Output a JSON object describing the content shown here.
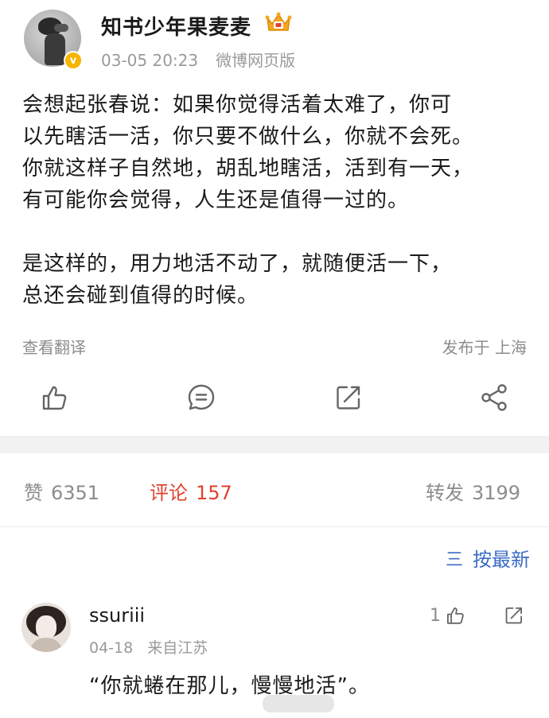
{
  "post": {
    "username": "知书少年果麦麦",
    "date": "03-05 20:23",
    "source": "微博网页版",
    "verify_mark": "v",
    "body_lines": [
      "会想起张春说：如果你觉得活着太难了，你可",
      "以先瞎活一活，你只要不做什么，你就不会死。",
      "你就这样子自然地，胡乱地瞎活，活到有一天，",
      "有可能你会觉得，人生还是值得一过的。"
    ],
    "body_lines_2": [
      "是这样的，用力地活不动了，就随便活一下，",
      "总还会碰到值得的时候。"
    ],
    "translate": "查看翻译",
    "location": "发布于 上海"
  },
  "actions": {
    "icons": [
      "like-icon",
      "comment-icon",
      "forward-icon",
      "share-icon"
    ]
  },
  "stats": {
    "like_label": "赞",
    "like_count": "6351",
    "comment_label": "评论",
    "comment_count": "157",
    "repost_label": "转发",
    "repost_count": "3199"
  },
  "sort": {
    "icon": "三",
    "label": "按最新"
  },
  "comment": {
    "username": "ssuriii",
    "date": "04-18",
    "from": "来自江苏",
    "likes": "1",
    "text": "“你就蜷在那儿，慢慢地活”。"
  },
  "colors": {
    "accent_red": "#e0422f",
    "link_blue": "#3b6cc4",
    "muted": "#8c8c8c",
    "badge": "#f7b500"
  }
}
